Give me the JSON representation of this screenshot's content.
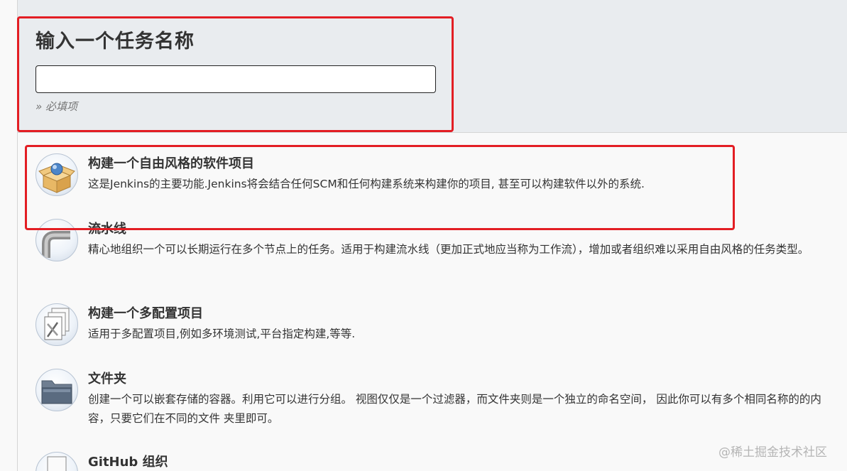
{
  "header": {
    "title": "输入一个任务名称",
    "name_input": {
      "value": "",
      "placeholder": ""
    },
    "required_hint": "» 必填项"
  },
  "items": [
    {
      "title": "构建一个自由风格的软件项目",
      "description": "这是Jenkins的主要功能.Jenkins将会结合任何SCM和任何构建系统来构建你的项目, 甚至可以构建软件以外的系统.",
      "icon": "package-box-icon"
    },
    {
      "title": "流水线",
      "description": "精心地组织一个可以长期运行在多个节点上的任务。适用于构建流水线（更加正式地应当称为工作流），增加或者组织难以采用自由风格的任务类型。",
      "icon": "pipe-icon"
    },
    {
      "title": "构建一个多配置项目",
      "description": "适用于多配置项目,例如多环境测试,平台指定构建,等等.",
      "icon": "multi-config-icon"
    },
    {
      "title": "文件夹",
      "description": "创建一个可以嵌套存储的容器。利用它可以进行分组。 视图仅仅是一个过滤器，而文件夹则是一个独立的命名空间， 因此你可以有多个相同名称的的内容，只要它们在不同的文件 夹里即可。",
      "icon": "folder-icon"
    },
    {
      "title": "GitHub 组织",
      "description": "",
      "icon": "github-org-icon"
    }
  ],
  "watermark": "@稀土掘金技术社区",
  "colors": {
    "highlight_box": "#e31e24",
    "header_bg": "#e9ecef",
    "page_bg": "#f9f9f9"
  }
}
